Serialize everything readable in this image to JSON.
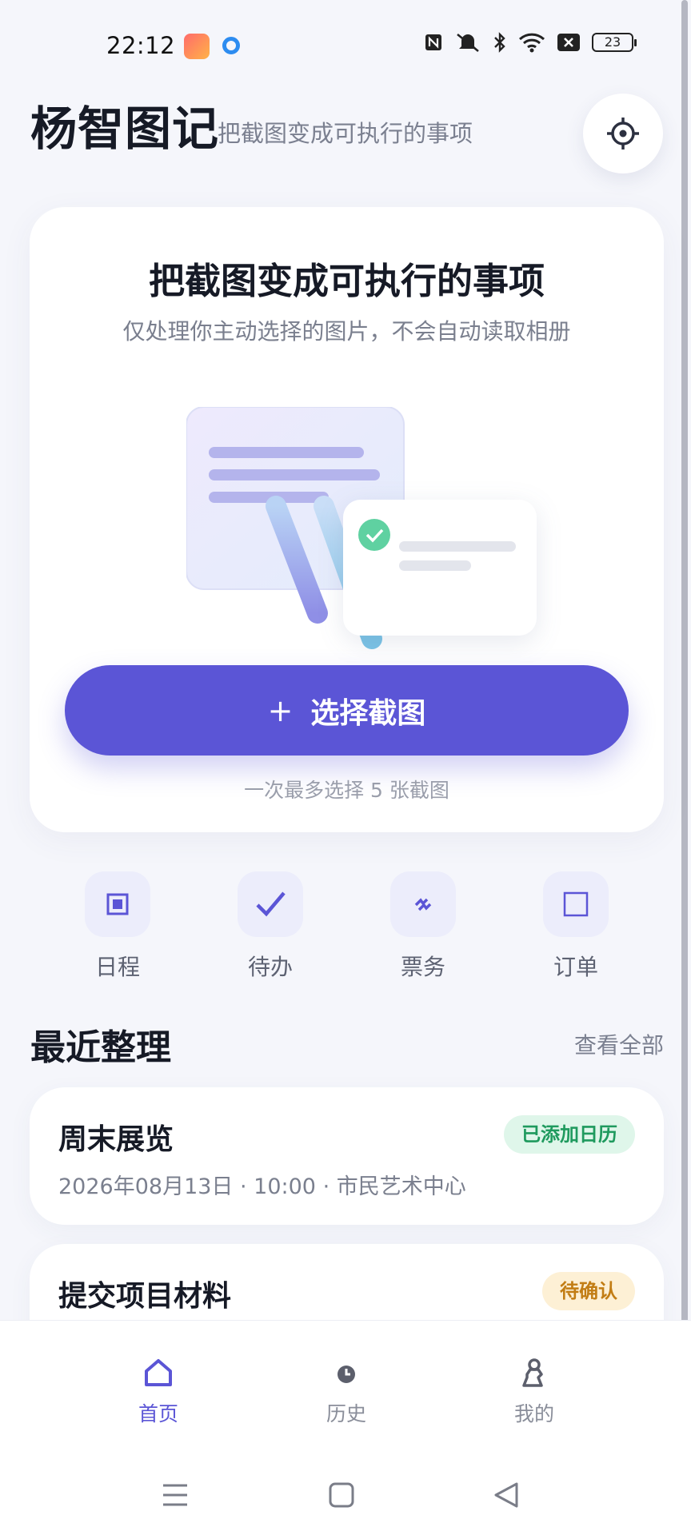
{
  "status_bar": {
    "time": "22:12",
    "battery": "23"
  },
  "header": {
    "title": "杨智图记",
    "subtitle": "把截图变成可执行的事项"
  },
  "hero": {
    "title": "把截图变成可执行的事项",
    "description": "仅处理你主动选择的图片，不会自动读取相册",
    "button_label": "选择截图",
    "button_icon": "+",
    "hint": "一次最多选择 5 张截图"
  },
  "categories": [
    {
      "label": "日程",
      "icon": "calendar-icon"
    },
    {
      "label": "待办",
      "icon": "check-icon"
    },
    {
      "label": "票务",
      "icon": "ticket-icon"
    },
    {
      "label": "订单",
      "icon": "order-icon"
    }
  ],
  "recent": {
    "title": "最近整理",
    "see_all": "查看全部",
    "items": [
      {
        "title": "周末展览",
        "meta": "2026年08月13日 · 10:00 · 市民艺术中心",
        "badge": "已添加日历",
        "badge_color": "#1f9a5e"
      },
      {
        "title": "提交项目材料",
        "badge": "待确认",
        "badge_color": "#c27d14"
      }
    ]
  },
  "bottom_nav": [
    {
      "label": "首页",
      "icon": "home-icon",
      "active": true
    },
    {
      "label": "历史",
      "icon": "history-icon",
      "active": false
    },
    {
      "label": "我的",
      "icon": "profile-icon",
      "active": false
    }
  ],
  "colors": {
    "accent": "#5b55d6",
    "background": "#f5f6fb"
  }
}
